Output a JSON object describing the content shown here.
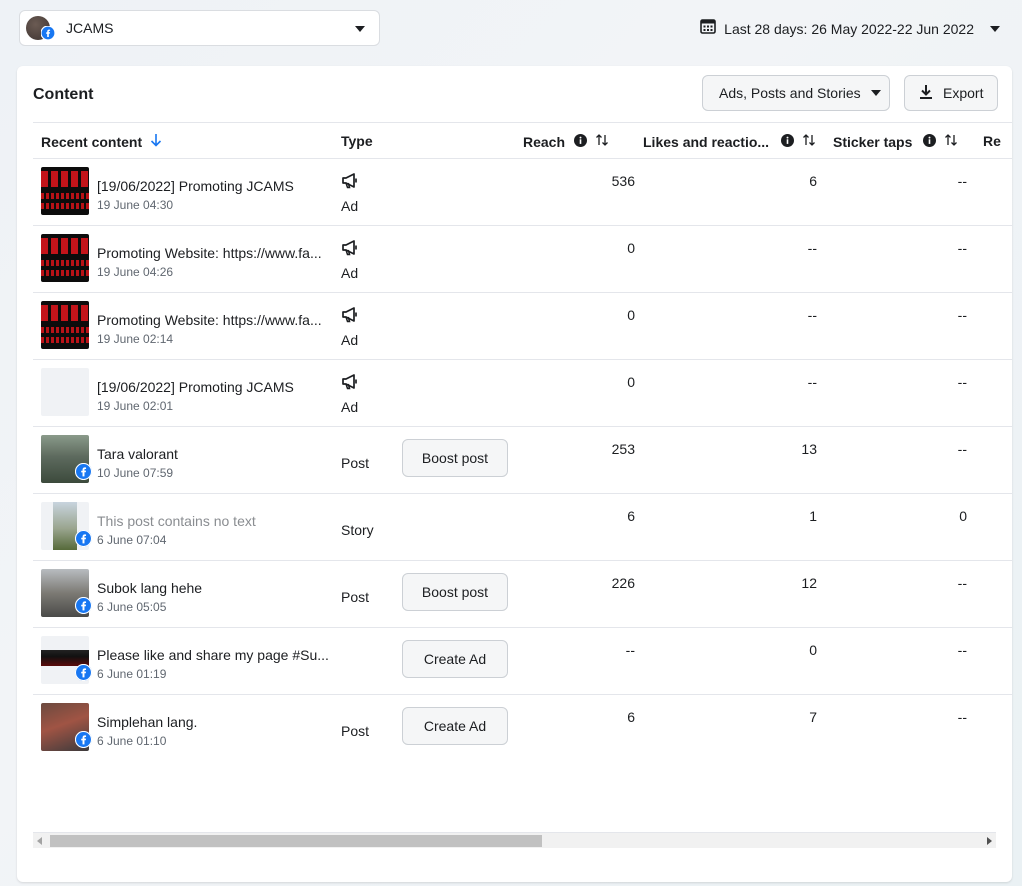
{
  "header": {
    "page_name": "JCAMS",
    "date_range": "Last 28 days: 26 May 2022-22 Jun 2022"
  },
  "content": {
    "title": "Content",
    "filter_label": "Ads, Posts and Stories",
    "export_label": "Export",
    "columns": {
      "recent": "Recent content",
      "type": "Type",
      "reach": "Reach",
      "likes": "Likes and reactio...",
      "sticker": "Sticker taps",
      "next": "Re"
    },
    "rows": [
      {
        "title": "[19/06/2022] Promoting JCAMS",
        "date": "19 June 04:30",
        "type": "Ad",
        "button": "",
        "reach": "536",
        "likes": "6",
        "sticker": "--"
      },
      {
        "title": "Promoting Website: https://www.fa...",
        "date": "19 June 04:26",
        "type": "Ad",
        "button": "",
        "reach": "0",
        "likes": "--",
        "sticker": "--"
      },
      {
        "title": "Promoting Website: https://www.fa...",
        "date": "19 June 02:14",
        "type": "Ad",
        "button": "",
        "reach": "0",
        "likes": "--",
        "sticker": "--"
      },
      {
        "title": "[19/06/2022] Promoting JCAMS",
        "date": "19 June 02:01",
        "type": "Ad",
        "button": "",
        "reach": "0",
        "likes": "--",
        "sticker": "--"
      },
      {
        "title": "Tara valorant",
        "date": "10 June 07:59",
        "type": "Post",
        "button": "Boost post",
        "reach": "253",
        "likes": "13",
        "sticker": "--"
      },
      {
        "title": "This post contains no text",
        "date": "6 June 07:04",
        "type": "Story",
        "button": "",
        "reach": "6",
        "likes": "1",
        "sticker": "0"
      },
      {
        "title": "Subok lang hehe",
        "date": "6 June 05:05",
        "type": "Post",
        "button": "Boost post",
        "reach": "226",
        "likes": "12",
        "sticker": "--"
      },
      {
        "title": "Please like and share my page #Su...",
        "date": "6 June 01:19",
        "type": "",
        "button": "Create Ad",
        "reach": "--",
        "likes": "0",
        "sticker": "--"
      },
      {
        "title": "Simplehan lang.",
        "date": "6 June 01:10",
        "type": "Post",
        "button": "Create Ad",
        "reach": "6",
        "likes": "7",
        "sticker": "--"
      }
    ]
  },
  "colors": {
    "accent": "#1877f2",
    "border": "#e4e6eb",
    "button_bg": "#f5f6f7"
  },
  "icons": {
    "page_select_caret": "caret-down-icon",
    "calendar": "calendar-icon",
    "export": "download-icon",
    "sort_active": "arrow-down-icon",
    "sort": "sort-arrows-icon",
    "info": "info-icon",
    "ad": "megaphone-icon",
    "badge": "facebook-badge-icon"
  }
}
